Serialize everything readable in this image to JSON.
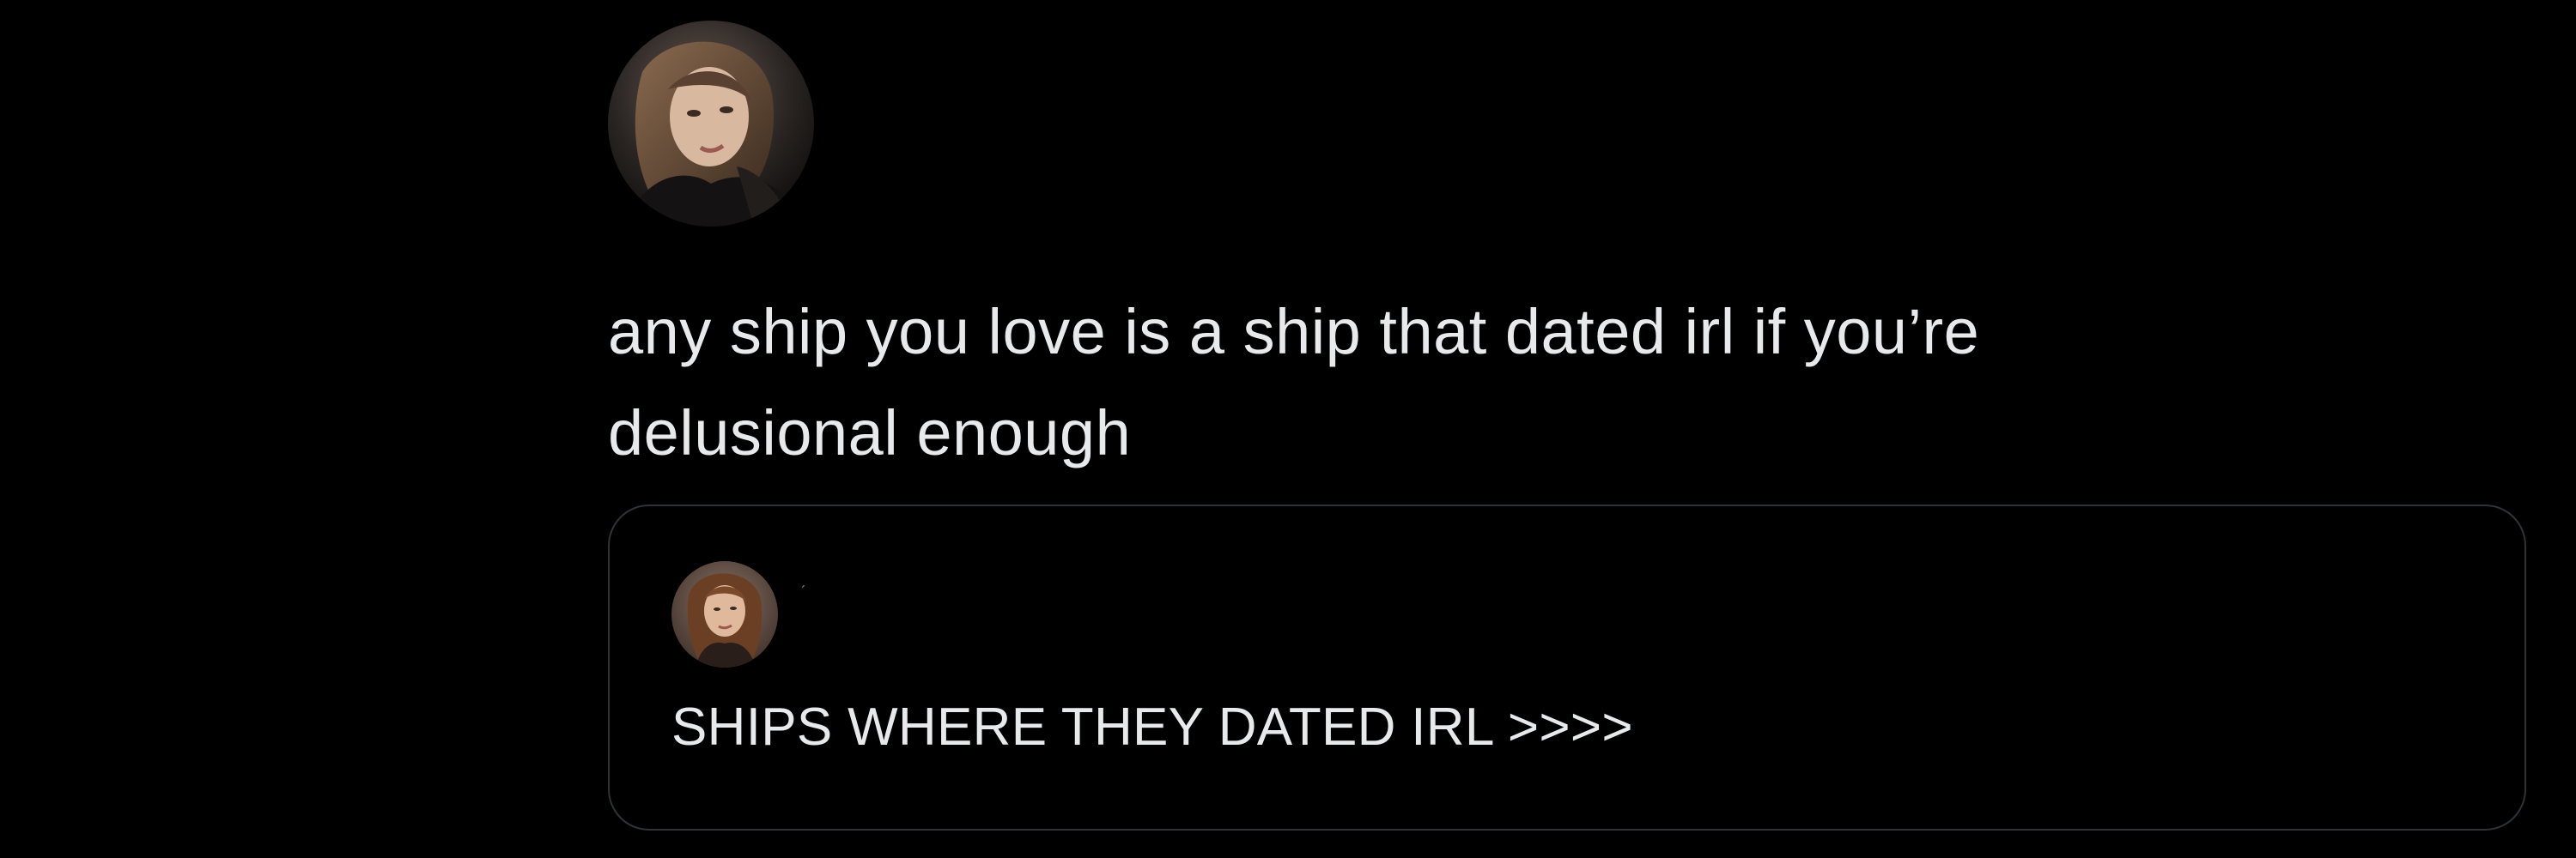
{
  "tweet": {
    "avatar_icon": "user-avatar-icon",
    "text_line1": "any ship you love is a ship that dated irl if you’re",
    "text_line2": "delusional enough"
  },
  "quoted_tweet": {
    "avatar_icon": "quoted-user-avatar-icon",
    "handle_mark": "ˊ",
    "text": "SHIPS WHERE THEY DATED IRL >>>>"
  },
  "colors": {
    "background": "#000000",
    "text": "#e7e9ea",
    "card_border": "#2f3336",
    "muted": "#71767b"
  }
}
